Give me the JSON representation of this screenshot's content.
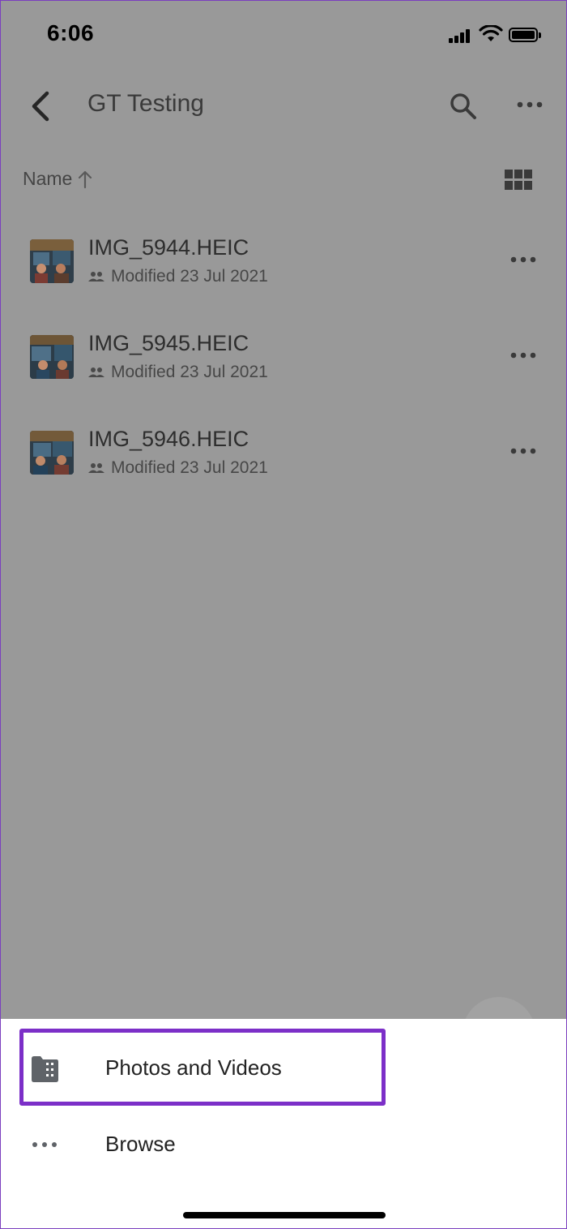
{
  "status": {
    "time": "6:06"
  },
  "header": {
    "title": "GT Testing"
  },
  "sort": {
    "label": "Name"
  },
  "files": [
    {
      "name": "IMG_5944.HEIC",
      "modified": "Modified 23 Jul 2021"
    },
    {
      "name": "IMG_5945.HEIC",
      "modified": "Modified 23 Jul 2021"
    },
    {
      "name": "IMG_5946.HEIC",
      "modified": "Modified 23 Jul 2021"
    }
  ],
  "sheet": {
    "options": [
      {
        "label": "Photos and Videos",
        "icon": "film-folder-icon"
      },
      {
        "label": "Browse",
        "icon": "more-horizontal-icon"
      }
    ]
  },
  "colors": {
    "overlay": "#999999",
    "highlight": "#7c2fc8"
  }
}
